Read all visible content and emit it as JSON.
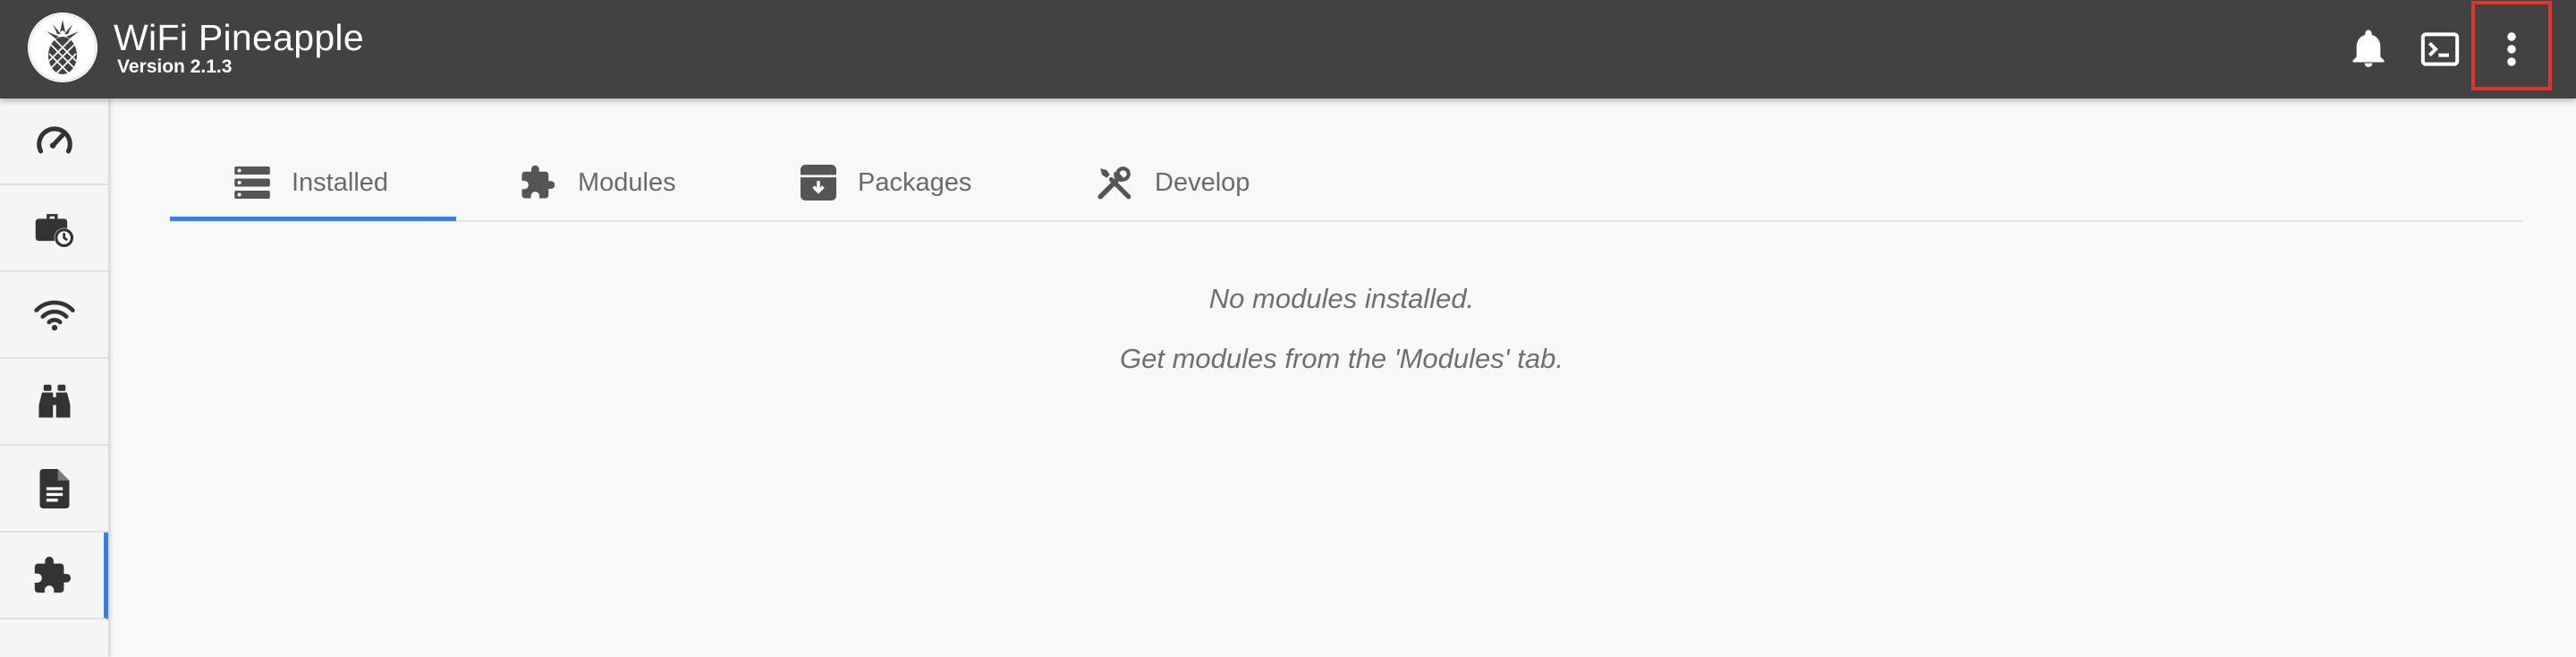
{
  "app": {
    "title": "WiFi Pineapple",
    "version": "Version 2.1.3"
  },
  "header_icons": [
    "bell-icon",
    "terminal-icon",
    "more-vert-icon"
  ],
  "sidebar": {
    "items": [
      {
        "icon": "dashboard-gauge-icon",
        "active": false
      },
      {
        "icon": "campaigns-briefcase-clock-icon",
        "active": false
      },
      {
        "icon": "wifi-icon",
        "active": false
      },
      {
        "icon": "recon-binoculars-icon",
        "active": false
      },
      {
        "icon": "logs-document-icon",
        "active": false
      },
      {
        "icon": "modules-puzzle-icon",
        "active": true
      }
    ]
  },
  "tabs": [
    {
      "label": "Installed",
      "icon": "list-icon",
      "active": true
    },
    {
      "label": "Modules",
      "icon": "puzzle-icon",
      "active": false
    },
    {
      "label": "Packages",
      "icon": "archive-icon",
      "active": false
    },
    {
      "label": "Develop",
      "icon": "tools-icon",
      "active": false
    }
  ],
  "content": {
    "empty_title": "No modules installed.",
    "empty_hint": "Get modules from the 'Modules' tab."
  },
  "colors": {
    "header": "#424242",
    "accent": "#3d7fd6",
    "highlight": "#e0352b",
    "icon": "#333333"
  }
}
